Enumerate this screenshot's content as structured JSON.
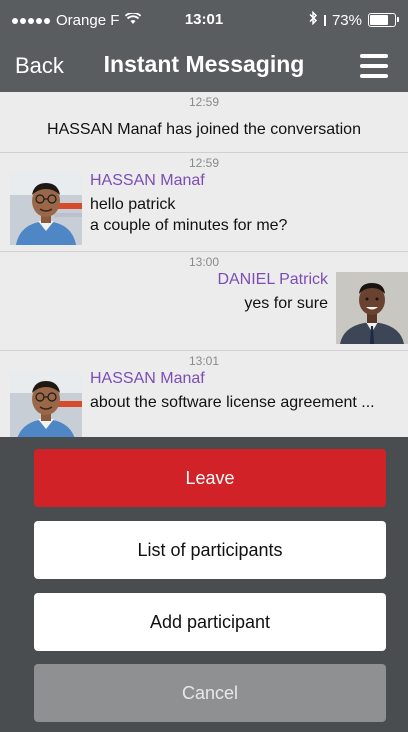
{
  "status_bar": {
    "carrier": "Orange F",
    "time": "13:01",
    "battery": "73%"
  },
  "nav": {
    "back_label": "Back",
    "title": "Instant Messaging"
  },
  "messages": [
    {
      "time": "12:59",
      "text": "HASSAN Manaf has joined the conversation"
    },
    {
      "time": "12:59",
      "sender": "HASSAN Manaf",
      "lines": [
        "hello patrick",
        "a couple of minutes for me?"
      ]
    },
    {
      "time": "13:00",
      "sender": "DANIEL Patrick",
      "lines": [
        "yes for sure"
      ]
    },
    {
      "time": "13:01",
      "sender": "HASSAN Manaf",
      "lines": [
        "about the software license agreement ..."
      ]
    }
  ],
  "action_sheet": {
    "leave_label": "Leave",
    "list_label": "List of participants",
    "add_label": "Add participant",
    "cancel_label": "Cancel"
  },
  "colors": {
    "accent_red": "#d12228",
    "sender_purple": "#7b4db5"
  },
  "icons": [
    "wifi-icon",
    "bluetooth-icon",
    "battery-icon",
    "menu-icon",
    "avatar-hassan",
    "avatar-daniel"
  ]
}
